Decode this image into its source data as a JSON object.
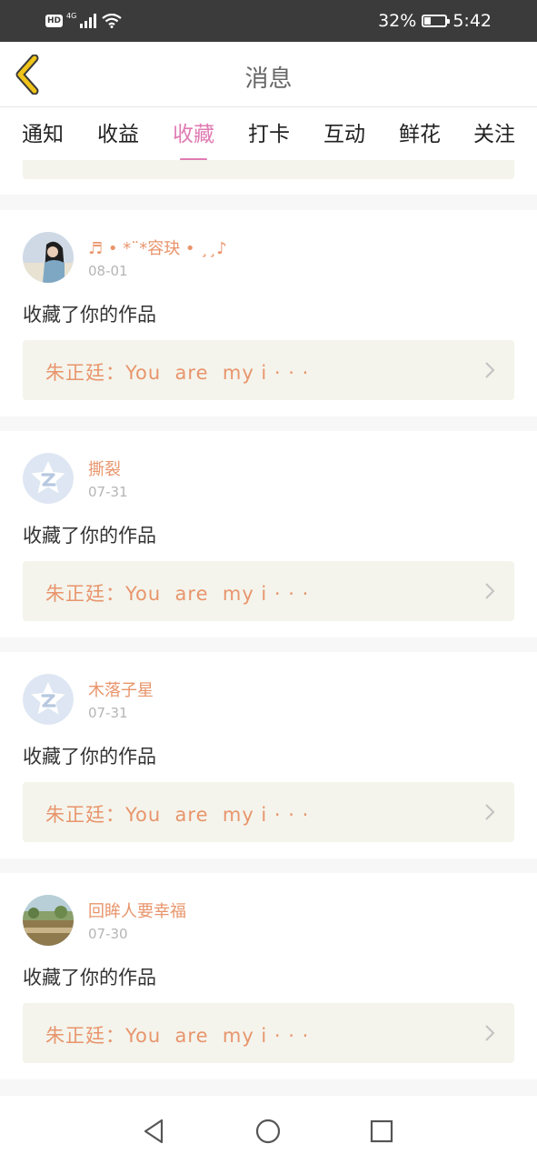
{
  "status_bar": {
    "hd": "HD",
    "signal_label": "4G",
    "battery_percent": "32%",
    "battery_level": 0.32,
    "time": "5:42"
  },
  "header": {
    "title": "消息",
    "back_icon": "chevron-left-icon",
    "accent_color": "#f0c419"
  },
  "tabs": [
    {
      "label": "通知",
      "active": false
    },
    {
      "label": "收益",
      "active": false
    },
    {
      "label": "收藏",
      "active": true
    },
    {
      "label": "打卡",
      "active": false
    },
    {
      "label": "互动",
      "active": false
    },
    {
      "label": "鲜花",
      "active": false
    },
    {
      "label": "关注",
      "active": false
    }
  ],
  "colors": {
    "active_tab": "#e07bb3",
    "username": "#e8956c",
    "work_box_bg": "#f4f4ec"
  },
  "notifications": [
    {
      "username": "♬ • *¨*容玦 • ¸¸♪",
      "date": "08-01",
      "action": "收藏了你的作品",
      "work_title": "朱正廷：You  are  my i · · ·",
      "avatar": "photo-avatar"
    },
    {
      "username": "撕裂",
      "date": "07-31",
      "action": "收藏了你的作品",
      "work_title": "朱正廷：You  are  my i · · ·",
      "avatar": "default-star-avatar"
    },
    {
      "username": "木落子星",
      "date": "07-31",
      "action": "收藏了你的作品",
      "work_title": "朱正廷：You  are  my i · · ·",
      "avatar": "default-star-avatar"
    },
    {
      "username": "回眸人要幸福",
      "date": "07-30",
      "action": "收藏了你的作品",
      "work_title": "朱正廷：You  are  my i · · ·",
      "avatar": "landscape-avatar"
    }
  ],
  "nav_bar": {
    "back": "triangle-back-icon",
    "home": "circle-home-icon",
    "recents": "square-recents-icon"
  }
}
